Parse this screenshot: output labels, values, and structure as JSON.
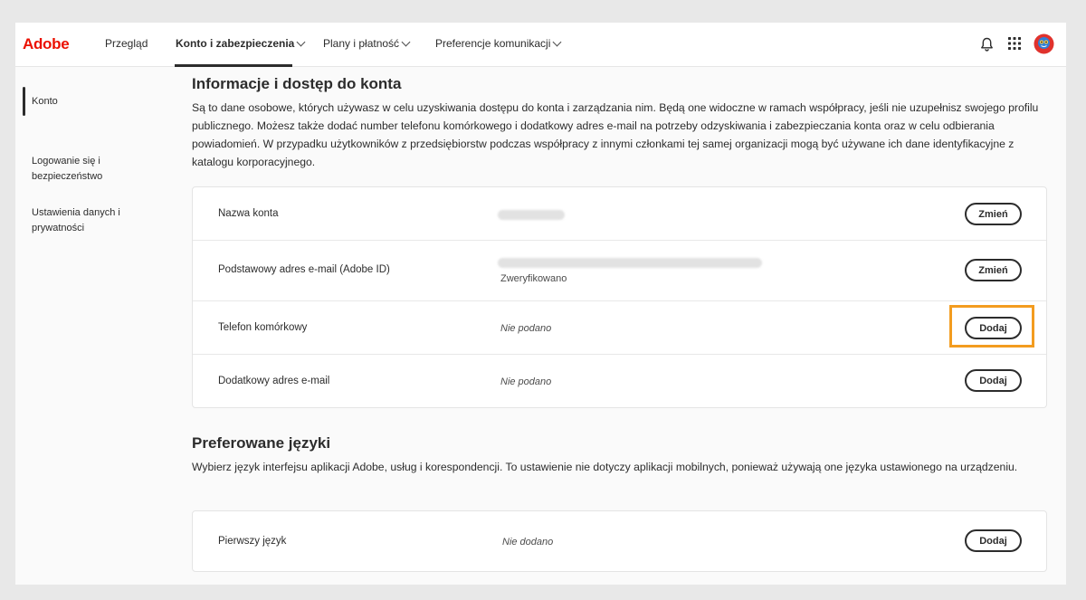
{
  "header": {
    "logo": "Adobe",
    "nav": [
      {
        "label": "Przegląd",
        "has_dropdown": false
      },
      {
        "label": "Konto i zabezpieczenia",
        "has_dropdown": true,
        "active": true
      },
      {
        "label": "Plany i płatność",
        "has_dropdown": true
      },
      {
        "label": "Preferencje komunikacji",
        "has_dropdown": true
      }
    ],
    "icons": [
      "bell-icon",
      "app-grid-icon",
      "avatar"
    ]
  },
  "sidebar": {
    "items": [
      {
        "label": "Konto",
        "active": true
      },
      {
        "label": "Logowanie się i bezpieczeństwo"
      },
      {
        "label": "Ustawienia danych i prywatności"
      }
    ]
  },
  "account_section": {
    "title": "Informacje i dostęp do konta",
    "description": "Są to dane osobowe, których używasz w celu uzyskiwania dostępu do konta i zarządzania nim. Będą one widoczne w ramach współpracy, jeśli nie uzupełnisz swojego profilu publicznego. Możesz także dodać number telefonu komórkowego i dodatkowy adres e-mail na potrzeby odzyskiwania i zabezpieczania konta oraz w celu odbierania powiadomień. W przypadku użytkowników z przedsiębiorstw podczas współpracy z innymi członkami tej samej organizacji mogą być używane ich dane identyfikacyjne z katalogu korporacyjnego.",
    "rows": [
      {
        "label": "Nazwa konta",
        "value": "",
        "sub": "",
        "button": "Zmień"
      },
      {
        "label": "Podstawowy adres e-mail (Adobe ID)",
        "value": "",
        "sub": "Zweryfikowano",
        "button": "Zmień"
      },
      {
        "label": "Telefon komórkowy",
        "value": "Nie podano",
        "sub": "",
        "button": "Dodaj",
        "highlighted": true
      },
      {
        "label": "Dodatkowy adres e-mail",
        "value": "Nie podano",
        "sub": "",
        "button": "Dodaj"
      }
    ]
  },
  "language_section": {
    "title": "Preferowane języki",
    "description": "Wybierz język interfejsu aplikacji Adobe, usług i korespondencji. To ustawienie nie dotyczy aplikacji mobilnych, ponieważ używają one języka ustawionego na urządzeniu.",
    "rows": [
      {
        "label": "Pierwszy język",
        "value": "Nie dodano",
        "button": "Dodaj"
      }
    ]
  },
  "colors": {
    "brand": "#eb1000",
    "highlight": "#f39c1f",
    "text": "#2c2c2c"
  }
}
